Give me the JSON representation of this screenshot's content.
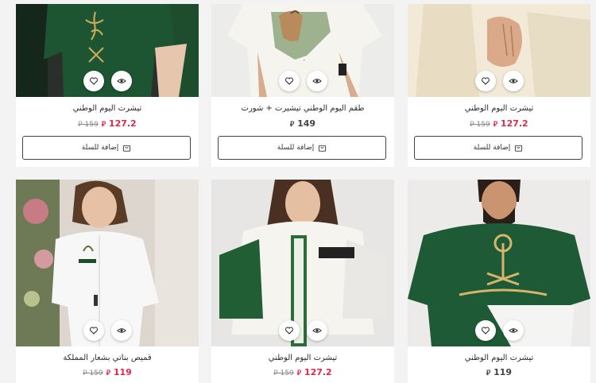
{
  "currency": "⃁",
  "cart_label": "إضافة للسلة",
  "products": [
    {
      "title": "تيشرت اليوم الوطني",
      "price": "127.2",
      "old_price": "159"
    },
    {
      "title": "طقم اليوم الوطني تيشيرت + شورت",
      "price": "149",
      "old_price": ""
    },
    {
      "title": "تيشرت اليوم الوطني",
      "price": "127.2",
      "old_price": "159"
    },
    {
      "title": "قميص بناتي بشعار المملكة",
      "price": "119",
      "old_price": "159"
    },
    {
      "title": "تيشرت اليوم الوطني",
      "price": "127.2",
      "old_price": "159"
    },
    {
      "title": "تيشرت اليوم الوطني",
      "price": "119",
      "old_price": ""
    }
  ],
  "colors": {
    "sale": "#e0284a",
    "green_shirt": "#1f5a37"
  }
}
